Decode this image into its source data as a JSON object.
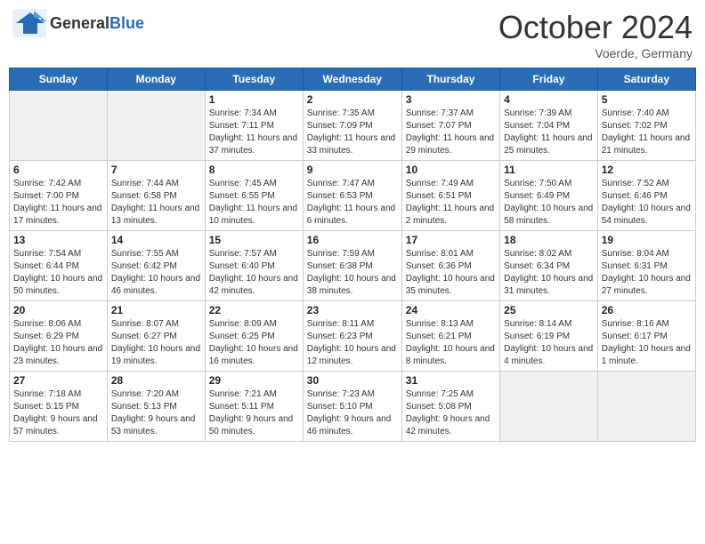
{
  "header": {
    "logo": {
      "general": "General",
      "blue": "Blue"
    },
    "title": "October 2024",
    "location": "Voerde, Germany"
  },
  "weekdays": [
    "Sunday",
    "Monday",
    "Tuesday",
    "Wednesday",
    "Thursday",
    "Friday",
    "Saturday"
  ],
  "weeks": [
    [
      {
        "day": "",
        "empty": true
      },
      {
        "day": "",
        "empty": true
      },
      {
        "day": "1",
        "sunrise": "Sunrise: 7:34 AM",
        "sunset": "Sunset: 7:11 PM",
        "daylight": "Daylight: 11 hours and 37 minutes."
      },
      {
        "day": "2",
        "sunrise": "Sunrise: 7:35 AM",
        "sunset": "Sunset: 7:09 PM",
        "daylight": "Daylight: 11 hours and 33 minutes."
      },
      {
        "day": "3",
        "sunrise": "Sunrise: 7:37 AM",
        "sunset": "Sunset: 7:07 PM",
        "daylight": "Daylight: 11 hours and 29 minutes."
      },
      {
        "day": "4",
        "sunrise": "Sunrise: 7:39 AM",
        "sunset": "Sunset: 7:04 PM",
        "daylight": "Daylight: 11 hours and 25 minutes."
      },
      {
        "day": "5",
        "sunrise": "Sunrise: 7:40 AM",
        "sunset": "Sunset: 7:02 PM",
        "daylight": "Daylight: 11 hours and 21 minutes."
      }
    ],
    [
      {
        "day": "6",
        "sunrise": "Sunrise: 7:42 AM",
        "sunset": "Sunset: 7:00 PM",
        "daylight": "Daylight: 11 hours and 17 minutes."
      },
      {
        "day": "7",
        "sunrise": "Sunrise: 7:44 AM",
        "sunset": "Sunset: 6:58 PM",
        "daylight": "Daylight: 11 hours and 13 minutes."
      },
      {
        "day": "8",
        "sunrise": "Sunrise: 7:45 AM",
        "sunset": "Sunset: 6:55 PM",
        "daylight": "Daylight: 11 hours and 10 minutes."
      },
      {
        "day": "9",
        "sunrise": "Sunrise: 7:47 AM",
        "sunset": "Sunset: 6:53 PM",
        "daylight": "Daylight: 11 hours and 6 minutes."
      },
      {
        "day": "10",
        "sunrise": "Sunrise: 7:49 AM",
        "sunset": "Sunset: 6:51 PM",
        "daylight": "Daylight: 11 hours and 2 minutes."
      },
      {
        "day": "11",
        "sunrise": "Sunrise: 7:50 AM",
        "sunset": "Sunset: 6:49 PM",
        "daylight": "Daylight: 10 hours and 58 minutes."
      },
      {
        "day": "12",
        "sunrise": "Sunrise: 7:52 AM",
        "sunset": "Sunset: 6:46 PM",
        "daylight": "Daylight: 10 hours and 54 minutes."
      }
    ],
    [
      {
        "day": "13",
        "sunrise": "Sunrise: 7:54 AM",
        "sunset": "Sunset: 6:44 PM",
        "daylight": "Daylight: 10 hours and 50 minutes."
      },
      {
        "day": "14",
        "sunrise": "Sunrise: 7:55 AM",
        "sunset": "Sunset: 6:42 PM",
        "daylight": "Daylight: 10 hours and 46 minutes."
      },
      {
        "day": "15",
        "sunrise": "Sunrise: 7:57 AM",
        "sunset": "Sunset: 6:40 PM",
        "daylight": "Daylight: 10 hours and 42 minutes."
      },
      {
        "day": "16",
        "sunrise": "Sunrise: 7:59 AM",
        "sunset": "Sunset: 6:38 PM",
        "daylight": "Daylight: 10 hours and 38 minutes."
      },
      {
        "day": "17",
        "sunrise": "Sunrise: 8:01 AM",
        "sunset": "Sunset: 6:36 PM",
        "daylight": "Daylight: 10 hours and 35 minutes."
      },
      {
        "day": "18",
        "sunrise": "Sunrise: 8:02 AM",
        "sunset": "Sunset: 6:34 PM",
        "daylight": "Daylight: 10 hours and 31 minutes."
      },
      {
        "day": "19",
        "sunrise": "Sunrise: 8:04 AM",
        "sunset": "Sunset: 6:31 PM",
        "daylight": "Daylight: 10 hours and 27 minutes."
      }
    ],
    [
      {
        "day": "20",
        "sunrise": "Sunrise: 8:06 AM",
        "sunset": "Sunset: 6:29 PM",
        "daylight": "Daylight: 10 hours and 23 minutes."
      },
      {
        "day": "21",
        "sunrise": "Sunrise: 8:07 AM",
        "sunset": "Sunset: 6:27 PM",
        "daylight": "Daylight: 10 hours and 19 minutes."
      },
      {
        "day": "22",
        "sunrise": "Sunrise: 8:09 AM",
        "sunset": "Sunset: 6:25 PM",
        "daylight": "Daylight: 10 hours and 16 minutes."
      },
      {
        "day": "23",
        "sunrise": "Sunrise: 8:11 AM",
        "sunset": "Sunset: 6:23 PM",
        "daylight": "Daylight: 10 hours and 12 minutes."
      },
      {
        "day": "24",
        "sunrise": "Sunrise: 8:13 AM",
        "sunset": "Sunset: 6:21 PM",
        "daylight": "Daylight: 10 hours and 8 minutes."
      },
      {
        "day": "25",
        "sunrise": "Sunrise: 8:14 AM",
        "sunset": "Sunset: 6:19 PM",
        "daylight": "Daylight: 10 hours and 4 minutes."
      },
      {
        "day": "26",
        "sunrise": "Sunrise: 8:16 AM",
        "sunset": "Sunset: 6:17 PM",
        "daylight": "Daylight: 10 hours and 1 minute."
      }
    ],
    [
      {
        "day": "27",
        "sunrise": "Sunrise: 7:18 AM",
        "sunset": "Sunset: 5:15 PM",
        "daylight": "Daylight: 9 hours and 57 minutes."
      },
      {
        "day": "28",
        "sunrise": "Sunrise: 7:20 AM",
        "sunset": "Sunset: 5:13 PM",
        "daylight": "Daylight: 9 hours and 53 minutes."
      },
      {
        "day": "29",
        "sunrise": "Sunrise: 7:21 AM",
        "sunset": "Sunset: 5:11 PM",
        "daylight": "Daylight: 9 hours and 50 minutes."
      },
      {
        "day": "30",
        "sunrise": "Sunrise: 7:23 AM",
        "sunset": "Sunset: 5:10 PM",
        "daylight": "Daylight: 9 hours and 46 minutes."
      },
      {
        "day": "31",
        "sunrise": "Sunrise: 7:25 AM",
        "sunset": "Sunset: 5:08 PM",
        "daylight": "Daylight: 9 hours and 42 minutes."
      },
      {
        "day": "",
        "empty": true
      },
      {
        "day": "",
        "empty": true
      }
    ]
  ]
}
